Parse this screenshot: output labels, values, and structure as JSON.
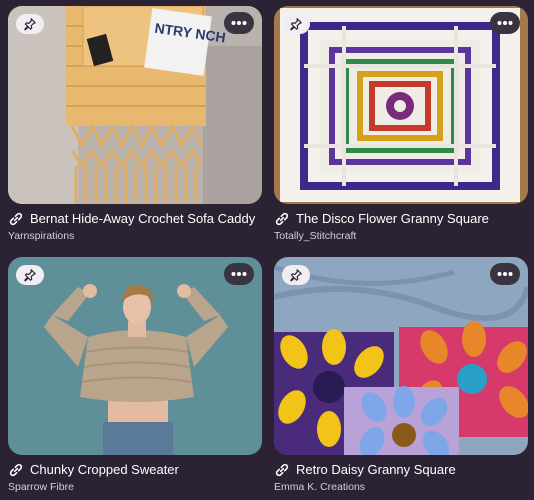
{
  "cards": [
    {
      "title": "Bernat Hide-Away Crochet Sofa Caddy",
      "source": "Yarnspirations",
      "book_text": "NTRY NCH"
    },
    {
      "title": "The Disco Flower Granny Square",
      "source": "Totally_Stitchcraft"
    },
    {
      "title": "Chunky Cropped Sweater",
      "source": "Sparrow Fibre"
    },
    {
      "title": "Retro Daisy Granny Square",
      "source": "Emma K. Creations"
    }
  ],
  "icons": {
    "pin": "pushpin-icon",
    "more": "ellipsis-icon",
    "link": "link-icon"
  },
  "colors": {
    "background": "#2b2333",
    "title": "#ffffff",
    "source": "#d6cfdb",
    "pin_button": "#f1eef3",
    "more_button": "#3a3440"
  }
}
